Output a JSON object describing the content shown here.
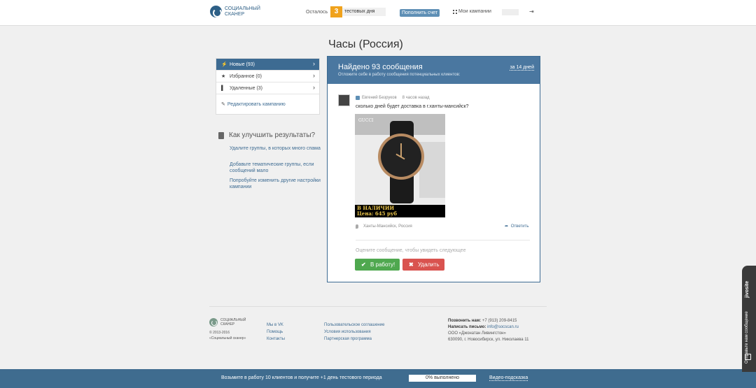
{
  "header": {
    "logo_line1": "СОЦИАЛЬНЫЙ",
    "logo_line2": "СКАНЕР",
    "remaining_label": "Осталось",
    "days_count": "3",
    "days_label": "тестовых дня",
    "topup_button": "Пополнить счет",
    "my_campaigns": "Мои кампании",
    "logout_icon": "logout-icon"
  },
  "page": {
    "title": "Часы (Россия)"
  },
  "sidebar": {
    "items": [
      {
        "icon": "lightning-icon",
        "label": "Новые (93)",
        "active": true
      },
      {
        "icon": "star-icon",
        "label": "Избранное (0)",
        "active": false
      },
      {
        "icon": "bookmark-icon",
        "label": "Удаленные (3)",
        "active": false
      }
    ],
    "edit_link": "Редактировать кампанию"
  },
  "help": {
    "title": "Как улучшить результаты?",
    "links": [
      "Удалите группы, в которых много спама",
      "Добавьте тематические группы, если сообщений мало",
      "Попробуйте изменить другие настройки кампании"
    ]
  },
  "panel": {
    "title": "Найдено 93 сообщения",
    "subtitle": "Отложите себе в работу сообщения потенциальных клиентов:",
    "period": "за 14 дней",
    "message": {
      "author": "Евгений Безруков",
      "time": "8 часов назад",
      "text": "сколько дней будет доставка в г.ханты-мансийск?",
      "photo_brand": "GUCCI",
      "photo_banner_line1": "В НАЛИЧИИ",
      "photo_banner_line2": "Цена: 645 руб",
      "location": "Ханты-Мансийск, Россия",
      "reply": "Ответить"
    },
    "rate_hint": "Оцените сообщение, чтобы увидеть следующее",
    "accept_button": "В работу!",
    "delete_button": "Удалить"
  },
  "footer": {
    "logo_line1": "СОЦИАЛЬНЫЙ",
    "logo_line2": "СКАНЕР",
    "copyright_line1": "© 2013-2016",
    "copyright_line2": "«Социальный сканер»",
    "col1": [
      "Мы в VK",
      "Помощь",
      "Контакты"
    ],
    "col2": [
      "Пользовательское соглашение",
      "Условия использования",
      "Партнерская программа"
    ],
    "phone_label": "Позвонить нам:",
    "phone": "+7 (913) 209-8415",
    "email_label": "Написать письмо:",
    "email": "info@socscan.ru",
    "company": "ООО «Джонатан Ливингстон»",
    "address": "630090, г. Новосибирск, ул. Николаева 11"
  },
  "bottom_bar": {
    "text": "Возьмите в работу 10 клиентов и получите +1 день тестового периода",
    "progress": "0% выполнено",
    "video": "Видео-подсказка"
  },
  "jivo": {
    "text": "Отправьте нам сообщение",
    "brand": "jivosite"
  },
  "colors": {
    "accent": "#3d6b92",
    "orange": "#f0a21c",
    "green": "#4fa84f",
    "red": "#d9534f"
  }
}
